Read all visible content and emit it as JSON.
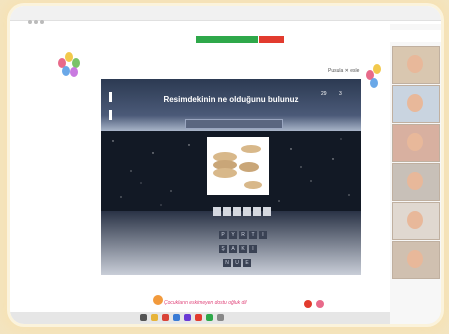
{
  "browser": {
    "url": "",
    "tabs": []
  },
  "meet": {
    "green_label": "",
    "red_label": ""
  },
  "page": {
    "top_right_text": "Pusula   ✕ esle"
  },
  "game": {
    "question": "Resimdekinin ne olduğunu bulunuz",
    "score": "29",
    "score2": "3",
    "banner": "",
    "answer_slots": 6,
    "letters_row1": [
      "P",
      "Y",
      "R",
      "T",
      "I"
    ],
    "letters_row2": [
      "Ş",
      "A",
      "K",
      "I"
    ],
    "letters_row3": [
      "N",
      "U",
      "E"
    ]
  },
  "footer": {
    "text": "Çocukların eskimeyen dostu oğluk dil"
  },
  "participants": {
    "count": 6
  },
  "colors": {
    "meet_green": "#2ea84a",
    "meet_red": "#e23b2e",
    "footer_pink": "#e0457a"
  }
}
